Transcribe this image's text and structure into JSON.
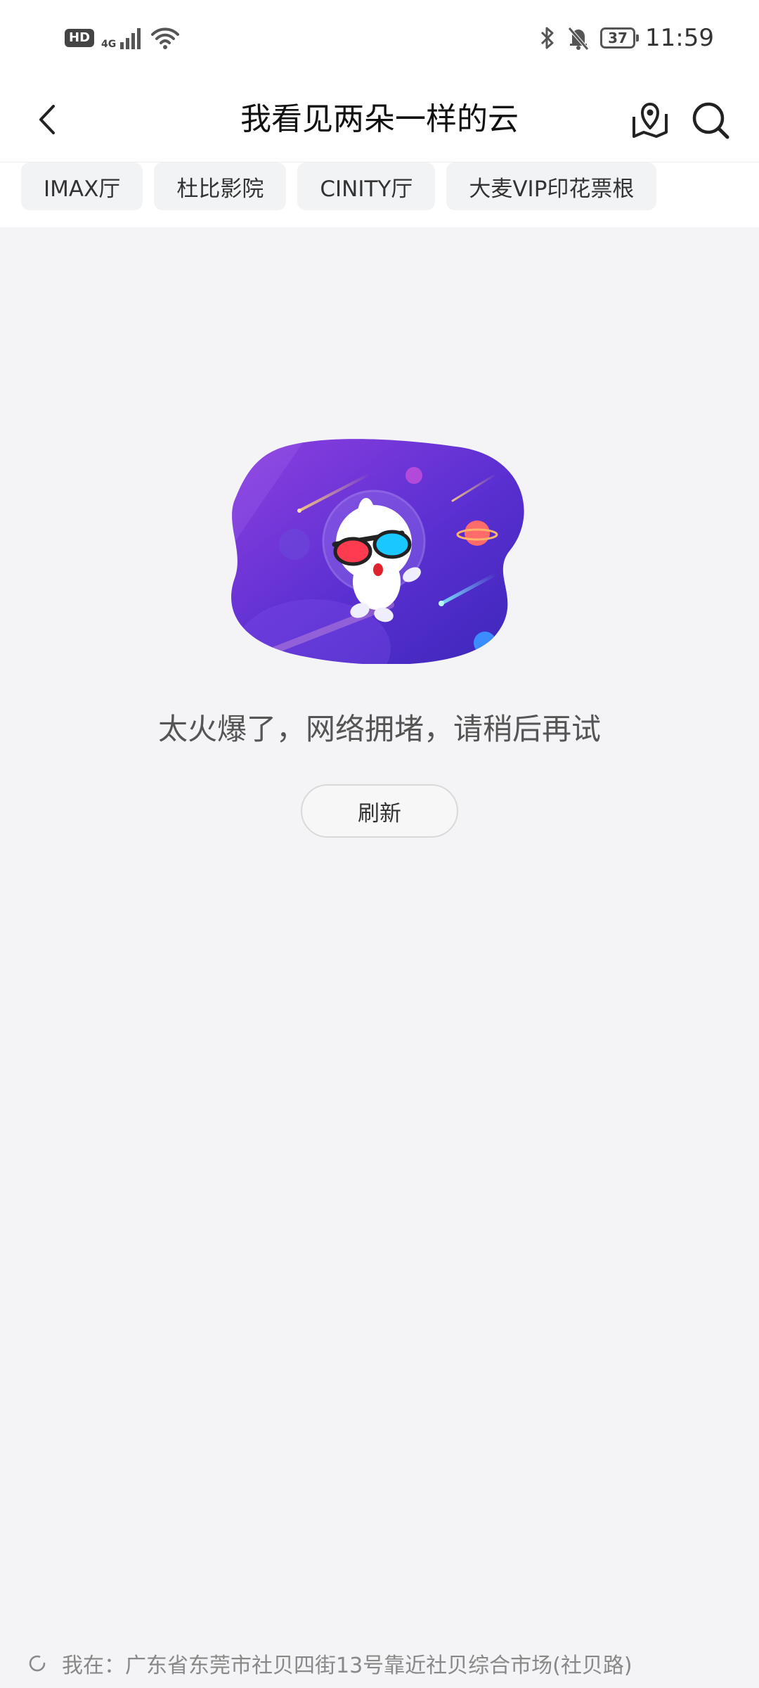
{
  "status_bar": {
    "hd": "HD",
    "network": "4G",
    "battery": "37",
    "time": "11:59"
  },
  "header": {
    "title": "我看见两朵一样的云",
    "icons": {
      "back": "chevron-left-icon",
      "map": "map-pin-icon",
      "search": "search-icon"
    }
  },
  "filters": {
    "chips": [
      "IMAX厅",
      "杜比影院",
      "CINITY厅",
      "大麦VIP印花票根"
    ]
  },
  "empty_state": {
    "message": "太火爆了，网络拥堵，请稍后再试",
    "refresh_label": "刷新"
  },
  "location": {
    "text": "我在：广东省东莞市社贝四街13号靠近社贝综合市场(社贝路)"
  },
  "colors": {
    "illustration_purple": "#5a2fd1",
    "illustration_light": "#8d5cf6",
    "glasses_red": "#ff3b4f",
    "glasses_blue": "#1bc7ff"
  }
}
